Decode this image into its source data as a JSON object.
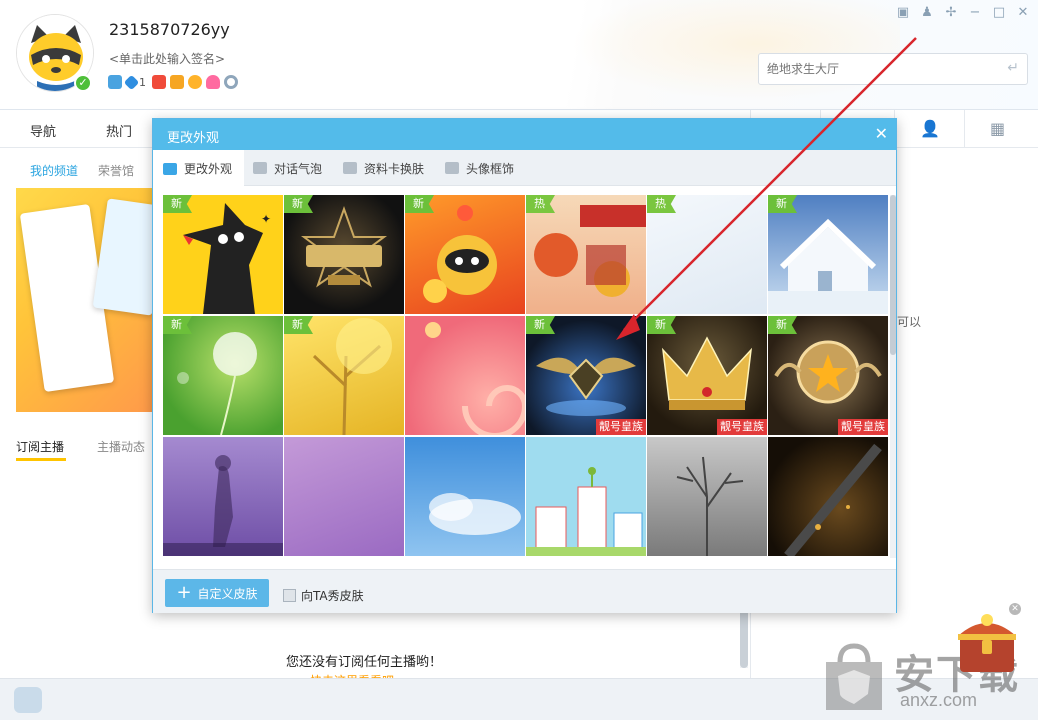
{
  "profile": {
    "username": "2315870726yy",
    "signature": "<单击此处输入签名>",
    "badge_count": "1"
  },
  "search": {
    "placeholder": "绝地求生大厅"
  },
  "nav": {
    "items": [
      "导航",
      "热门"
    ]
  },
  "left": {
    "subtabs": [
      "我的频道",
      "荣誉馆"
    ],
    "bottom_tabs": [
      "订阅主播",
      "主播动态"
    ],
    "empty_text": "您还没有订阅任何主播哟！",
    "empty_link": "快去这里看看吧~"
  },
  "right": {
    "partial_text": "可以"
  },
  "dialog": {
    "title": "更改外观",
    "tabs": [
      "更改外观",
      "对话气泡",
      "资料卡换肤",
      "头像框饰"
    ],
    "custom_button": "自定义皮肤",
    "show_skin_label": "向TA秀皮肤",
    "skins": [
      {
        "tag": "新",
        "label": ""
      },
      {
        "tag": "新",
        "label": ""
      },
      {
        "tag": "新",
        "label": ""
      },
      {
        "tag": "热",
        "label": ""
      },
      {
        "tag": "热",
        "label": ""
      },
      {
        "tag": "新",
        "label": ""
      },
      {
        "tag": "新",
        "label": ""
      },
      {
        "tag": "新",
        "label": ""
      },
      {
        "tag": "",
        "label": ""
      },
      {
        "tag": "新",
        "label": "靓号皇族"
      },
      {
        "tag": "新",
        "label": "靓号皇族"
      },
      {
        "tag": "新",
        "label": "靓号皇族"
      },
      {
        "tag": "",
        "label": ""
      },
      {
        "tag": "",
        "label": ""
      },
      {
        "tag": "",
        "label": ""
      },
      {
        "tag": "",
        "label": ""
      },
      {
        "tag": "",
        "label": ""
      },
      {
        "tag": "",
        "label": ""
      }
    ]
  },
  "watermark": {
    "text": "安下载",
    "url": "anxz.com"
  },
  "colors": {
    "accent": "#53bbea",
    "tag_green": "#6cc03a",
    "label_red": "#e23b3b",
    "arrow_red": "#d8252c"
  }
}
